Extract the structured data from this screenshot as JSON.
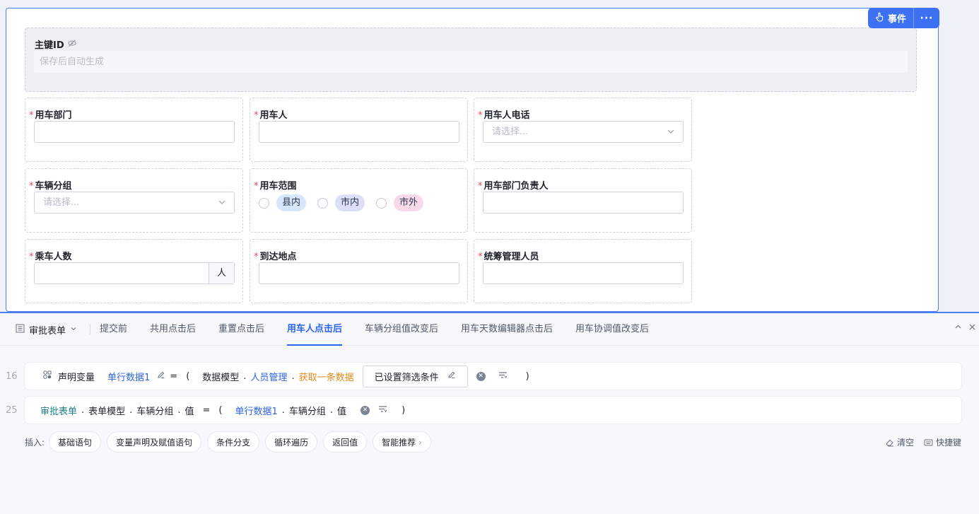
{
  "designer": {
    "event_button": "事件",
    "more_button": "···",
    "primary_key": {
      "label": "主键ID",
      "placeholder": "保存后自动生成"
    },
    "fields": [
      {
        "label": "用车部门",
        "required": "*",
        "kind": "input",
        "value": ""
      },
      {
        "label": "用车人",
        "required": "*",
        "kind": "input",
        "value": ""
      },
      {
        "label": "用车人电话",
        "required": "*",
        "kind": "select",
        "placeholder": "请选择..."
      },
      {
        "label": "车辆分组",
        "required": "*",
        "kind": "select",
        "placeholder": "请选择..."
      },
      {
        "label": "用车范围",
        "required": "*",
        "kind": "radio",
        "options": [
          "县内",
          "市内",
          "市外"
        ]
      },
      {
        "label": "用车部门负责人",
        "required": "*",
        "kind": "input",
        "value": ""
      },
      {
        "label": "乘车人数",
        "required": "*",
        "kind": "input-suffix",
        "suffix": "人"
      },
      {
        "label": "到达地点",
        "required": "*",
        "kind": "input",
        "value": ""
      },
      {
        "label": "统筹管理人员",
        "required": "*",
        "kind": "input",
        "value": ""
      }
    ]
  },
  "editor": {
    "form_selector": "审批表单",
    "tabs": [
      "提交前",
      "共用点击后",
      "重置点击后",
      "用车人点击后",
      "车辆分组值改变后",
      "用车天数编辑器点击后",
      "用车协调值改变后"
    ],
    "active_tab": "用车人点击后",
    "lines": [
      {
        "line_no": "16",
        "keyword": "声明变量",
        "variable": "单行数据1",
        "assign": "=",
        "open": "(",
        "model": "数据模型",
        "dot": ".",
        "entity": "人员管理",
        "method": "获取一条数据",
        "filter": "已设置筛选条件",
        "close": ")"
      },
      {
        "line_no": "25",
        "target_form": "审批表单",
        "target_model": "表单模型",
        "target_field": "车辆分组",
        "target_prop": "值",
        "assign": "=",
        "open": "(",
        "src_var": "单行数据1",
        "src_field": "车辆分组",
        "src_prop": "值",
        "dot": ".",
        "close": ")"
      }
    ],
    "insert": {
      "label": "插入:",
      "chips": [
        "基础语句",
        "变量声明及赋值语句",
        "条件分支",
        "循环遍历",
        "返回值",
        "智能推荐"
      ],
      "clear": "清空",
      "shortcut": "快捷键"
    },
    "colors": {
      "accent": "#3e70f2",
      "active_tab": "#2d63e8",
      "method": "#e88a1a",
      "required": "#e34d59"
    }
  }
}
